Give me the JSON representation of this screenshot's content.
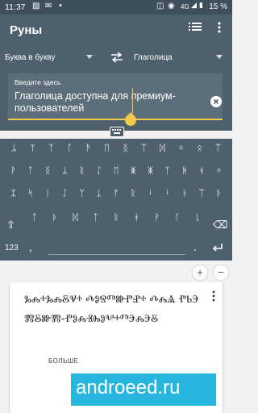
{
  "status": {
    "time": "11:37",
    "network": "4G",
    "battery": "15 %"
  },
  "app": {
    "title": "Руны"
  },
  "languages": {
    "source": "Буква в букву",
    "target": "Глаголица"
  },
  "input": {
    "placeholder": "Введите здесь",
    "value": "Глаголица доступна для премиум-пользователей"
  },
  "keyboard": {
    "rows": [
      [
        "ᛦ",
        "ᛘ",
        "ᛉ",
        "ᚪ",
        "ᚫ",
        "ᛖ",
        "ᛝ",
        "ᛠ",
        "ᛞ",
        "ᛜ",
        "ᛟ",
        "ᛠ"
      ],
      [
        "ᚹ",
        "ᛏ",
        "ᛝ",
        "ᛦ",
        "ᚱ",
        "ᛇ",
        "ᛖ",
        "ᛤ",
        "ᛤ",
        "ᛉ",
        "ᚻ",
        "ᚼ",
        "ᛜ"
      ],
      [
        "ᛯ",
        "ᛋ",
        "ᛁ",
        "ᛇ",
        "ᛘ",
        "ᛣ",
        "ᚠ",
        "ᚱ",
        "ᛍ",
        "ᛍ",
        "ᚾ",
        "ᛠ",
        "ᚦ"
      ],
      [
        "ᛏ",
        "ᚦ",
        "ᛞ",
        "ᛏ",
        "ᚱ",
        "ᚼ",
        "ᚹ",
        "ᚴ",
        "ᚳ"
      ]
    ],
    "mode": "123",
    "comma": ",",
    "period": "."
  },
  "result": {
    "text": "ⰃⰎⰰⰃⰎⰋⰜⰰ ⰄⰑⰔⰕⰖⰒⰐⰰ ⰄⰎⰡ ⰒⰓⰅⰏⰋⰖⰏ-ⰒⰑⰎⰠⰈⰑⰂⰰⰕⰅⰎⰅⰋ",
    "section_label": "БОЛЬШЕ"
  },
  "zoom": {
    "plus": "+",
    "minus": "−"
  },
  "watermark": "androeed.ru"
}
